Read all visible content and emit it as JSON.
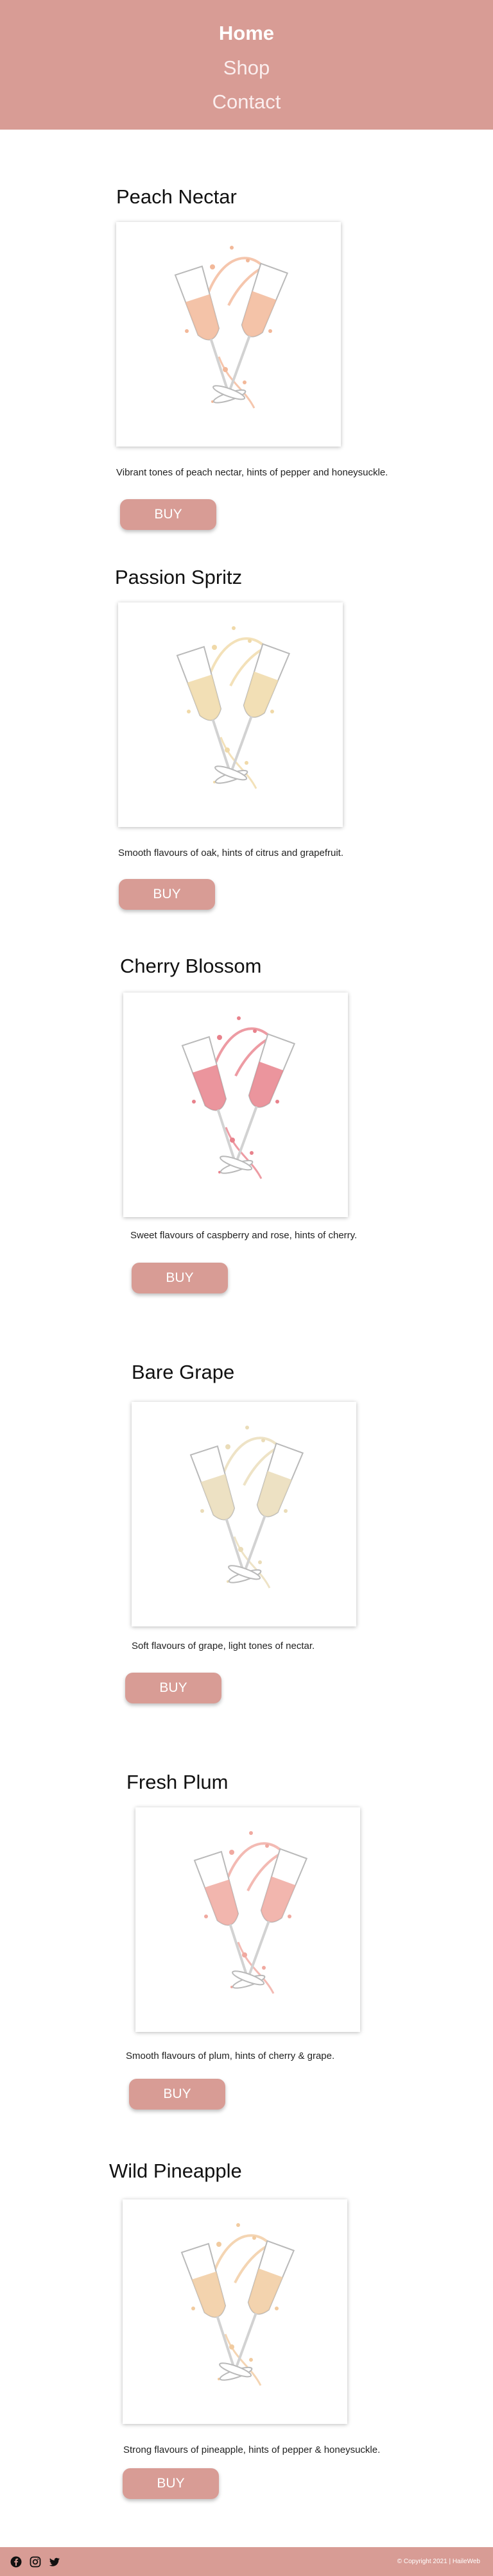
{
  "nav": {
    "home": "Home",
    "shop": "Shop",
    "contact": "Contact"
  },
  "products": [
    {
      "title": "Peach Nectar",
      "description": "Vibrant tones of peach nectar, hints of pepper and honeysuckle.",
      "buy_label": "BUY",
      "wine_color": "#f2b899"
    },
    {
      "title": "Passion Spritz",
      "description": "Smooth flavours of oak, hints of citrus and grapefruit.",
      "buy_label": "BUY",
      "wine_color": "#f0d9a8"
    },
    {
      "title": "Cherry Blossom",
      "description": "Sweet flavours of caspberry and rose, hints of cherry.",
      "buy_label": "BUY",
      "wine_color": "#e8828c"
    },
    {
      "title": "Bare Grape",
      "description": "Soft flavours of grape, light tones of nectar.",
      "buy_label": "BUY",
      "wine_color": "#eadcb8"
    },
    {
      "title": "Fresh Plum",
      "description": "Smooth flavours of plum, hints of cherry & grape.",
      "buy_label": "BUY",
      "wine_color": "#f0a9a0"
    },
    {
      "title": "Wild Pineapple",
      "description": "Strong flavours of pineapple, hints of pepper & honeysuckle.",
      "buy_label": "BUY",
      "wine_color": "#f1cba0"
    }
  ],
  "footer": {
    "copyright": "© Copyright 2021 | HaileWeb",
    "icons": [
      "facebook-icon",
      "instagram-icon",
      "twitter-icon"
    ]
  },
  "colors": {
    "brand": "#d89c95",
    "text": "#111111"
  }
}
